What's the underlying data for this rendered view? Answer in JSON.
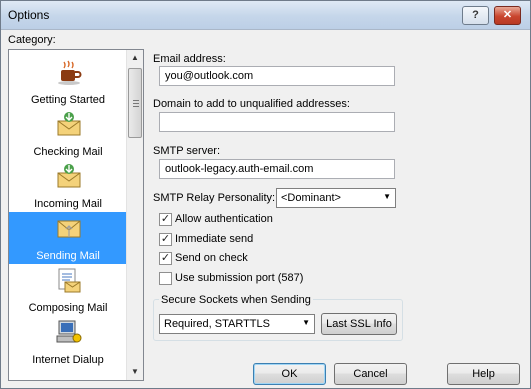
{
  "window": {
    "title": "Options"
  },
  "titlebar": {
    "help_glyph": "?",
    "close_glyph": "✕"
  },
  "category": {
    "label": "Category:",
    "items": [
      {
        "label": "Getting Started",
        "icon": "coffee-cup-icon"
      },
      {
        "label": "Checking Mail",
        "icon": "checking-mail-icon"
      },
      {
        "label": "Incoming Mail",
        "icon": "incoming-mail-icon"
      },
      {
        "label": "Sending Mail",
        "icon": "sending-mail-icon",
        "selected": true
      },
      {
        "label": "Composing Mail",
        "icon": "composing-mail-icon"
      },
      {
        "label": "Internet Dialup",
        "icon": "dialup-computer-icon"
      }
    ]
  },
  "form": {
    "email_label": "Email address:",
    "email_value": "you@outlook.com",
    "domain_label": "Domain to add to unqualified addresses:",
    "domain_value": "",
    "smtp_label": "SMTP server:",
    "smtp_value": "outlook-legacy.auth-email.com",
    "relay_label": "SMTP Relay Personality:",
    "relay_value": "<Dominant>",
    "checkboxes": [
      {
        "label": "Allow authentication",
        "checked": true
      },
      {
        "label": "Immediate send",
        "checked": true
      },
      {
        "label": "Send on check",
        "checked": true
      },
      {
        "label": "Use submission port (587)",
        "checked": false
      }
    ],
    "ssl_group_label": "Secure Sockets when Sending",
    "ssl_value": "Required, STARTTLS",
    "last_ssl_button": "Last SSL Info"
  },
  "buttons": {
    "ok": "OK",
    "cancel": "Cancel",
    "help": "Help"
  },
  "colors": {
    "selection": "#3399ff",
    "titlebar": "#c5d6ea",
    "close_button": "#c9452e"
  }
}
